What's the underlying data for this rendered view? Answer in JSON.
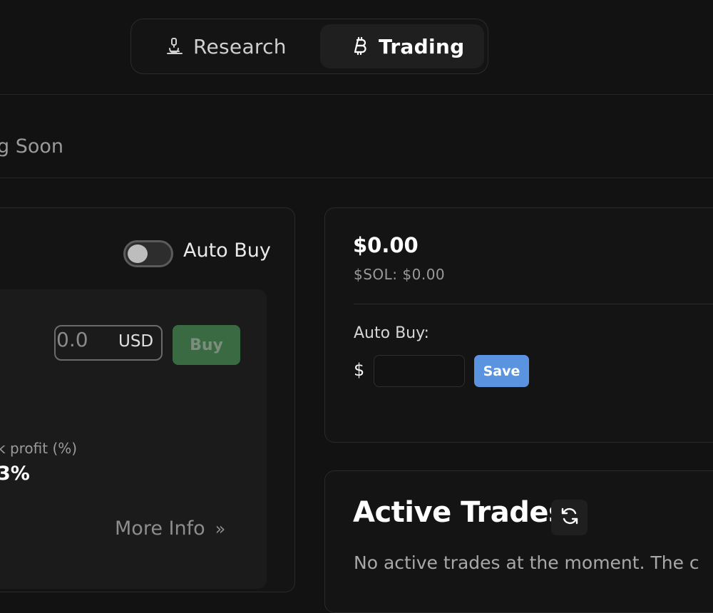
{
  "tabs": [
    {
      "label": "Research",
      "icon": "microscope-icon"
    },
    {
      "label": "Trading",
      "icon": "bitcoin-icon",
      "active": true
    }
  ],
  "banner": {
    "text": "g Soon"
  },
  "left_panel": {
    "auto_buy_label": "Auto Buy",
    "auto_buy_enabled": false,
    "amount_value": "0.0",
    "amount_unit": "USD",
    "buy_label": "Buy",
    "take_profit_label": "k profit (%)",
    "take_profit_value": "3%",
    "more_info_label": "More Info",
    "more_info_chevron": "»"
  },
  "wallet": {
    "balance": "$0.00",
    "sol_balance": "$SOL: $0.00",
    "auto_buy_label": "Auto Buy:",
    "currency_symbol": "$",
    "auto_buy_amount": "",
    "save_label": "Save"
  },
  "active_trades": {
    "title": "Active Trades",
    "empty_message": "No active trades at the moment. The c"
  },
  "colors": {
    "background": "#121212",
    "buy_button": "#3a6a42",
    "save_button": "#5a93e0"
  }
}
